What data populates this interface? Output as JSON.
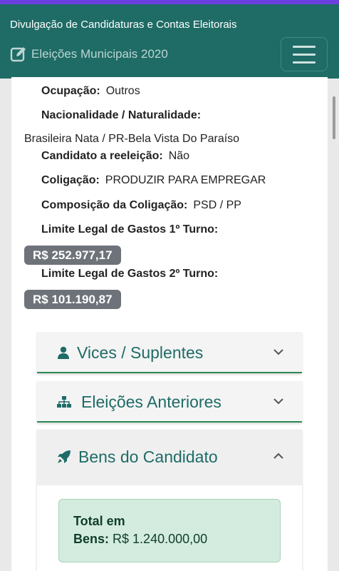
{
  "header": {
    "site_title": "Divulgação de Candidaturas e Contas Eleitorais",
    "brand": "Eleições Municipais 2020"
  },
  "details": {
    "ocupacao_label": "Ocupação:",
    "ocupacao_value": "Outros",
    "nacionalidade_label": "Nacionalidade / Naturalidade:",
    "nacionalidade_value": "Brasileira Nata / PR-Bela Vista Do Paraíso",
    "reeleicao_label": "Candidato a reeleição:",
    "reeleicao_value": "Não",
    "coligacao_label": "Coligação:",
    "coligacao_value": "PRODUZIR PARA EMPREGAR",
    "composicao_label": "Composição da Coligação:",
    "composicao_value": "PSD / PP",
    "limite1_label": "Limite Legal de Gastos 1º Turno:",
    "limite1_value": "R$ 252.977,17",
    "limite2_label": "Limite Legal de Gastos 2º Turno:",
    "limite2_value": "R$ 101.190,87"
  },
  "panels": {
    "vices": "Vices / Suplentes",
    "eleicoes": "Eleições Anteriores",
    "bens": "Bens do Candidato"
  },
  "bens": {
    "total_label_line1": "Total em",
    "total_label_line2": "Bens:",
    "total_value": "R$ 1.240.000,00"
  },
  "colors": {
    "header": "#1f6b66",
    "accent": "#2d8a55",
    "badge": "#6e737a"
  }
}
